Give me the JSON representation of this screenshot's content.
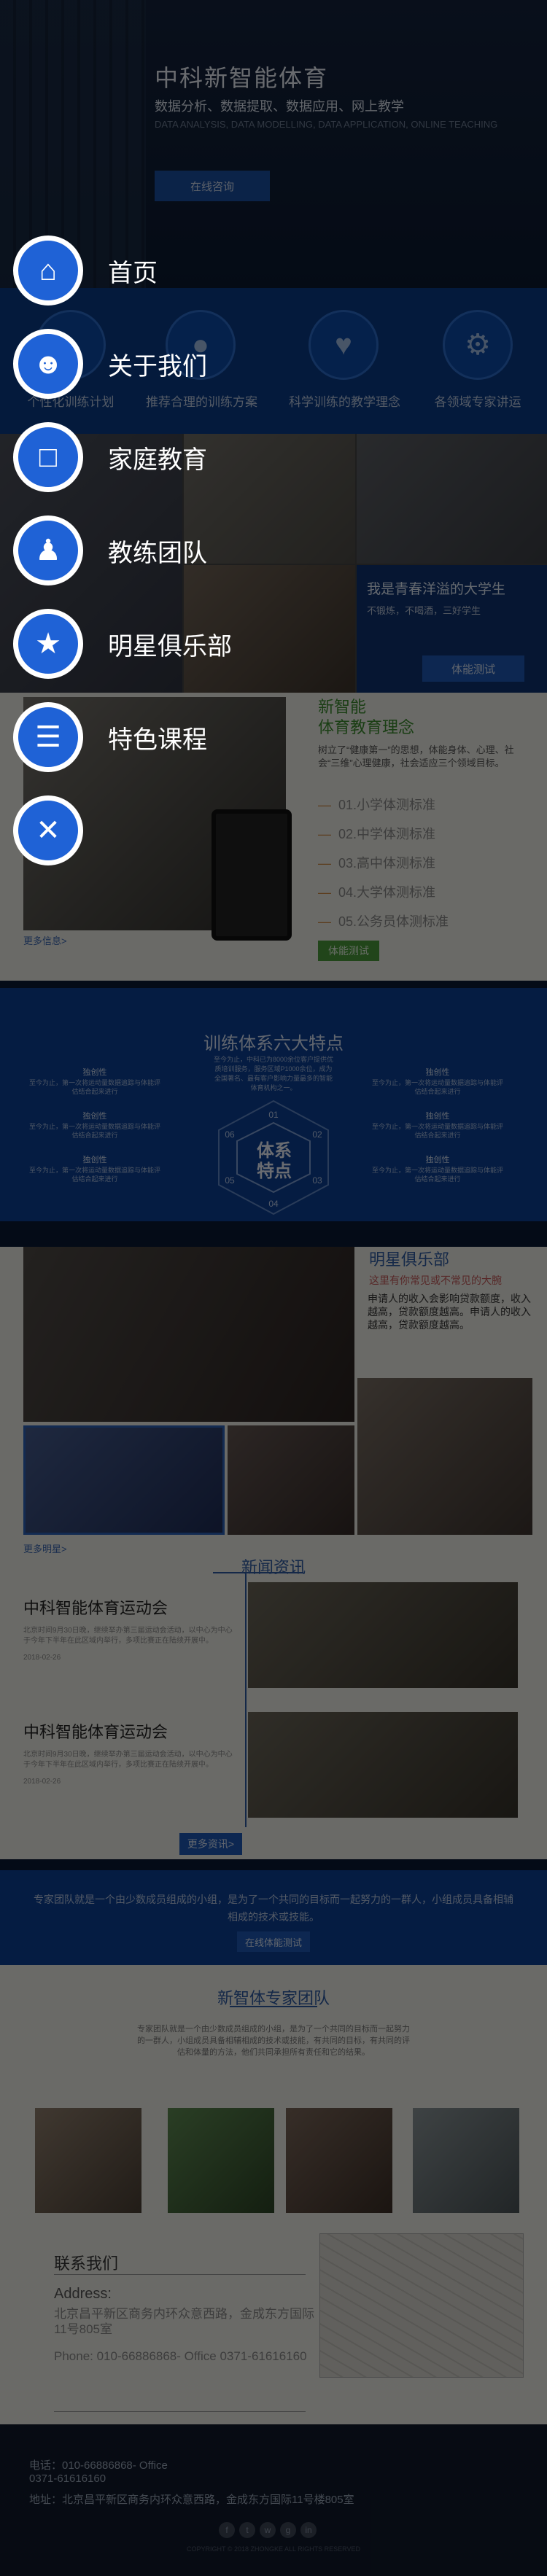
{
  "hero": {
    "title": "中科新智能体育",
    "subtitle": "数据分析、数据提取、数据应用、网上教学",
    "english": "DATA ANALYSIS, DATA MODELLING, DATA APPLICATION, ONLINE TEACHING",
    "button": "在线咨询"
  },
  "strip": {
    "items": [
      {
        "label": "个性化训练计划",
        "icon": "person-icon"
      },
      {
        "label": "推荐合理的训练方案",
        "icon": "globe-icon"
      },
      {
        "label": "科学训练的教学理念",
        "icon": "heart-hand-icon"
      },
      {
        "label": "各领域专家讲运",
        "icon": "gear-icon"
      }
    ]
  },
  "photos1": {
    "caption_title": "我是青春洋溢的大学生",
    "caption_sub": "不锻炼，不喝酒，三好学生",
    "button": "体能测试"
  },
  "concept": {
    "title": "新智能\n体育教育理念",
    "text": "树立了“健康第一”的思想，体能身体、心理、社会“三维”心理健康，社会适应三个领域目标。",
    "items": [
      "01.小学体测标准",
      "02.中学体测标准",
      "03.高中体测标准",
      "04.大学体测标准",
      "05.公务员体测标准"
    ],
    "button": "体能测试",
    "more": "更多信息>"
  },
  "six": {
    "title": "训练体系六大特点",
    "desc": "至今为止，中科已为8000余位客户提供优质培训服务，服务区域P1000余位，成为全国著名、最有客户影响力量最多的智能体育机构之一。",
    "center": "体系\n特点",
    "numbers": [
      "01",
      "02",
      "03",
      "04",
      "05",
      "06"
    ],
    "left": [
      {
        "title": "独创性",
        "text": "至今为止，第一次将运动量数据追踪与体能评估结合起来进行"
      },
      {
        "title": "独创性",
        "text": "至今为止，第一次将运动量数据追踪与体能评估结合起来进行"
      },
      {
        "title": "独创性",
        "text": "至今为止，第一次将运动量数据追踪与体能评估结合起来进行"
      }
    ],
    "right": [
      {
        "title": "独创性",
        "text": "至今为止，第一次将运动量数据追踪与体能评估结合起来进行"
      },
      {
        "title": "独创性",
        "text": "至今为止，第一次将运动量数据追踪与体能评估结合起来进行"
      },
      {
        "title": "独创性",
        "text": "至今为止，第一次将运动量数据追踪与体能评估结合起来进行"
      }
    ]
  },
  "club": {
    "title": "明星俱乐部",
    "subtitle": "这里有你常见或不常见的大腕",
    "text": "申请人的收入会影响贷款额度，收入越高，贷款额度越高。申请人的收入越高，贷款额度越高。",
    "more": "更多明星>"
  },
  "news": {
    "title": "新闻资讯",
    "items": [
      {
        "title": "中科智能体育运动会",
        "desc": "北京时间9月30日晚，继续举办第三届运动会活动，以中心为中心于今年下半年在此区域内举行，多项比赛正在陆续开展中。",
        "date": "2018-02-26"
      },
      {
        "title": "中科智能体育运动会",
        "desc": "北京时间9月30日晚，继续举办第三届运动会活动，以中心为中心于今年下半年在此区域内举行，多项比赛正在陆续开展中。",
        "date": "2018-02-26"
      }
    ],
    "more": "更多资讯>"
  },
  "banner": {
    "text": "专家团队就是一个由少数成员组成的小组，是为了一个共同的目标而一起努力的一群人，小组成员具备相辅相成的技术或技能。",
    "button": "在线体能测试"
  },
  "team": {
    "title": "新智体专家团队",
    "text": "专家团队就是一个由少数成员组成的小组，是为了一个共同的目标而一起努力的一群人，小组成员具备相辅相成的技术或技能，有共同的目标，有共同的评估和体量的方法，他们共同承担所有责任和它的结果。"
  },
  "contact": {
    "title": "联系我们",
    "address_label": "Address:",
    "address": "北京昌平新区商务内环众意西路，金成东方国际11号805室",
    "phone": "Phone: 010-66886868- Office 0371-61616160"
  },
  "footer": {
    "phone": "电话：010-66886868- Office\n0371-61616160",
    "address": "地址：北京昌平新区商务内环众意西路，金成东方国际11号楼805室",
    "copyright": "COPYRIGHT © 2018 ZHONGKE ALL RIGHTS RESERVED"
  },
  "menu": {
    "items": [
      {
        "label": "首页",
        "icon": "home-icon"
      },
      {
        "label": "关于我们",
        "icon": "user-icon"
      },
      {
        "label": "家庭教育",
        "icon": "book-icon"
      },
      {
        "label": "教练团队",
        "icon": "team-icon"
      },
      {
        "label": "明星俱乐部",
        "icon": "cheers-icon"
      },
      {
        "label": "特色课程",
        "icon": "document-icon"
      }
    ],
    "close_icon": "close-icon"
  },
  "colors": {
    "accent": "#1f62d6",
    "brand_blue": "#0d3f92",
    "green": "#4a9a3a"
  }
}
